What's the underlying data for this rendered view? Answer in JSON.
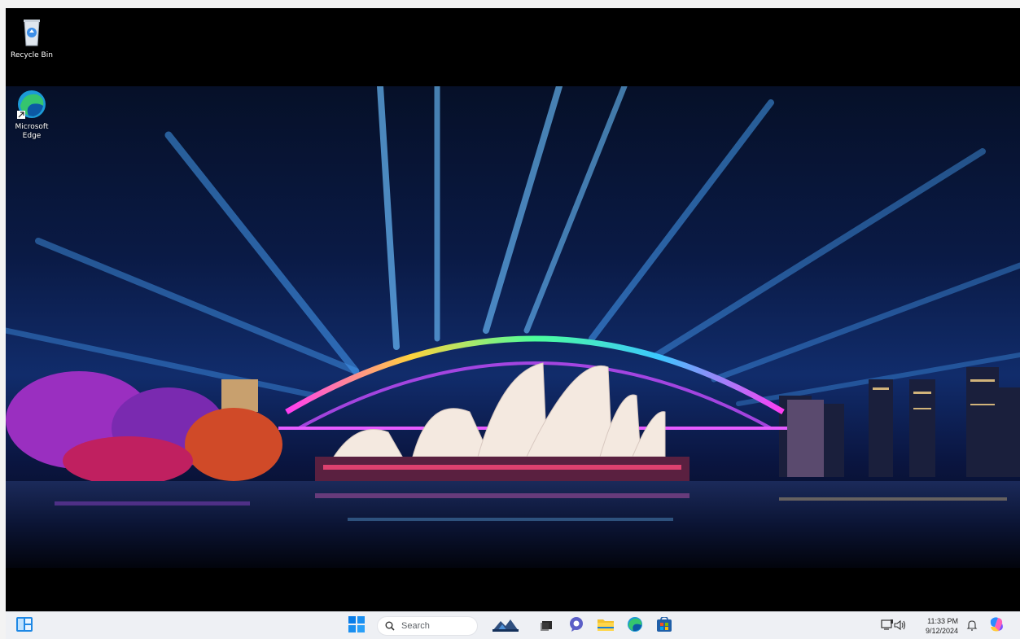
{
  "desktop": {
    "icons": [
      {
        "label": "Recycle Bin",
        "icon": "recycle-bin-icon"
      },
      {
        "label": "Microsoft Edge",
        "label_line1": "Microsoft",
        "label_line2": "Edge",
        "icon": "edge-icon"
      }
    ],
    "wallpaper": "Sydney Harbour Bridge and Opera House illuminated at night"
  },
  "taskbar": {
    "widgets_icon": "widgets-icon",
    "start_icon": "windows-start-icon",
    "search": {
      "placeholder": "Search",
      "icon": "search-icon"
    },
    "pinned": [
      {
        "name": "copilot-landscape-icon"
      },
      {
        "name": "task-view-icon"
      },
      {
        "name": "chat-icon"
      },
      {
        "name": "file-explorer-icon"
      },
      {
        "name": "edge-icon"
      },
      {
        "name": "microsoft-store-icon"
      }
    ],
    "tray": {
      "time": "11:33 PM",
      "date": "9/12/2024",
      "network_icon": "network-icon",
      "volume_icon": "volume-icon",
      "notification_icon": "bell-icon",
      "copilot_icon": "copilot-icon"
    }
  },
  "colors": {
    "taskbar_bg": "#eef0f4",
    "accent": "#0067c0",
    "desktop_bg": "#000000"
  }
}
